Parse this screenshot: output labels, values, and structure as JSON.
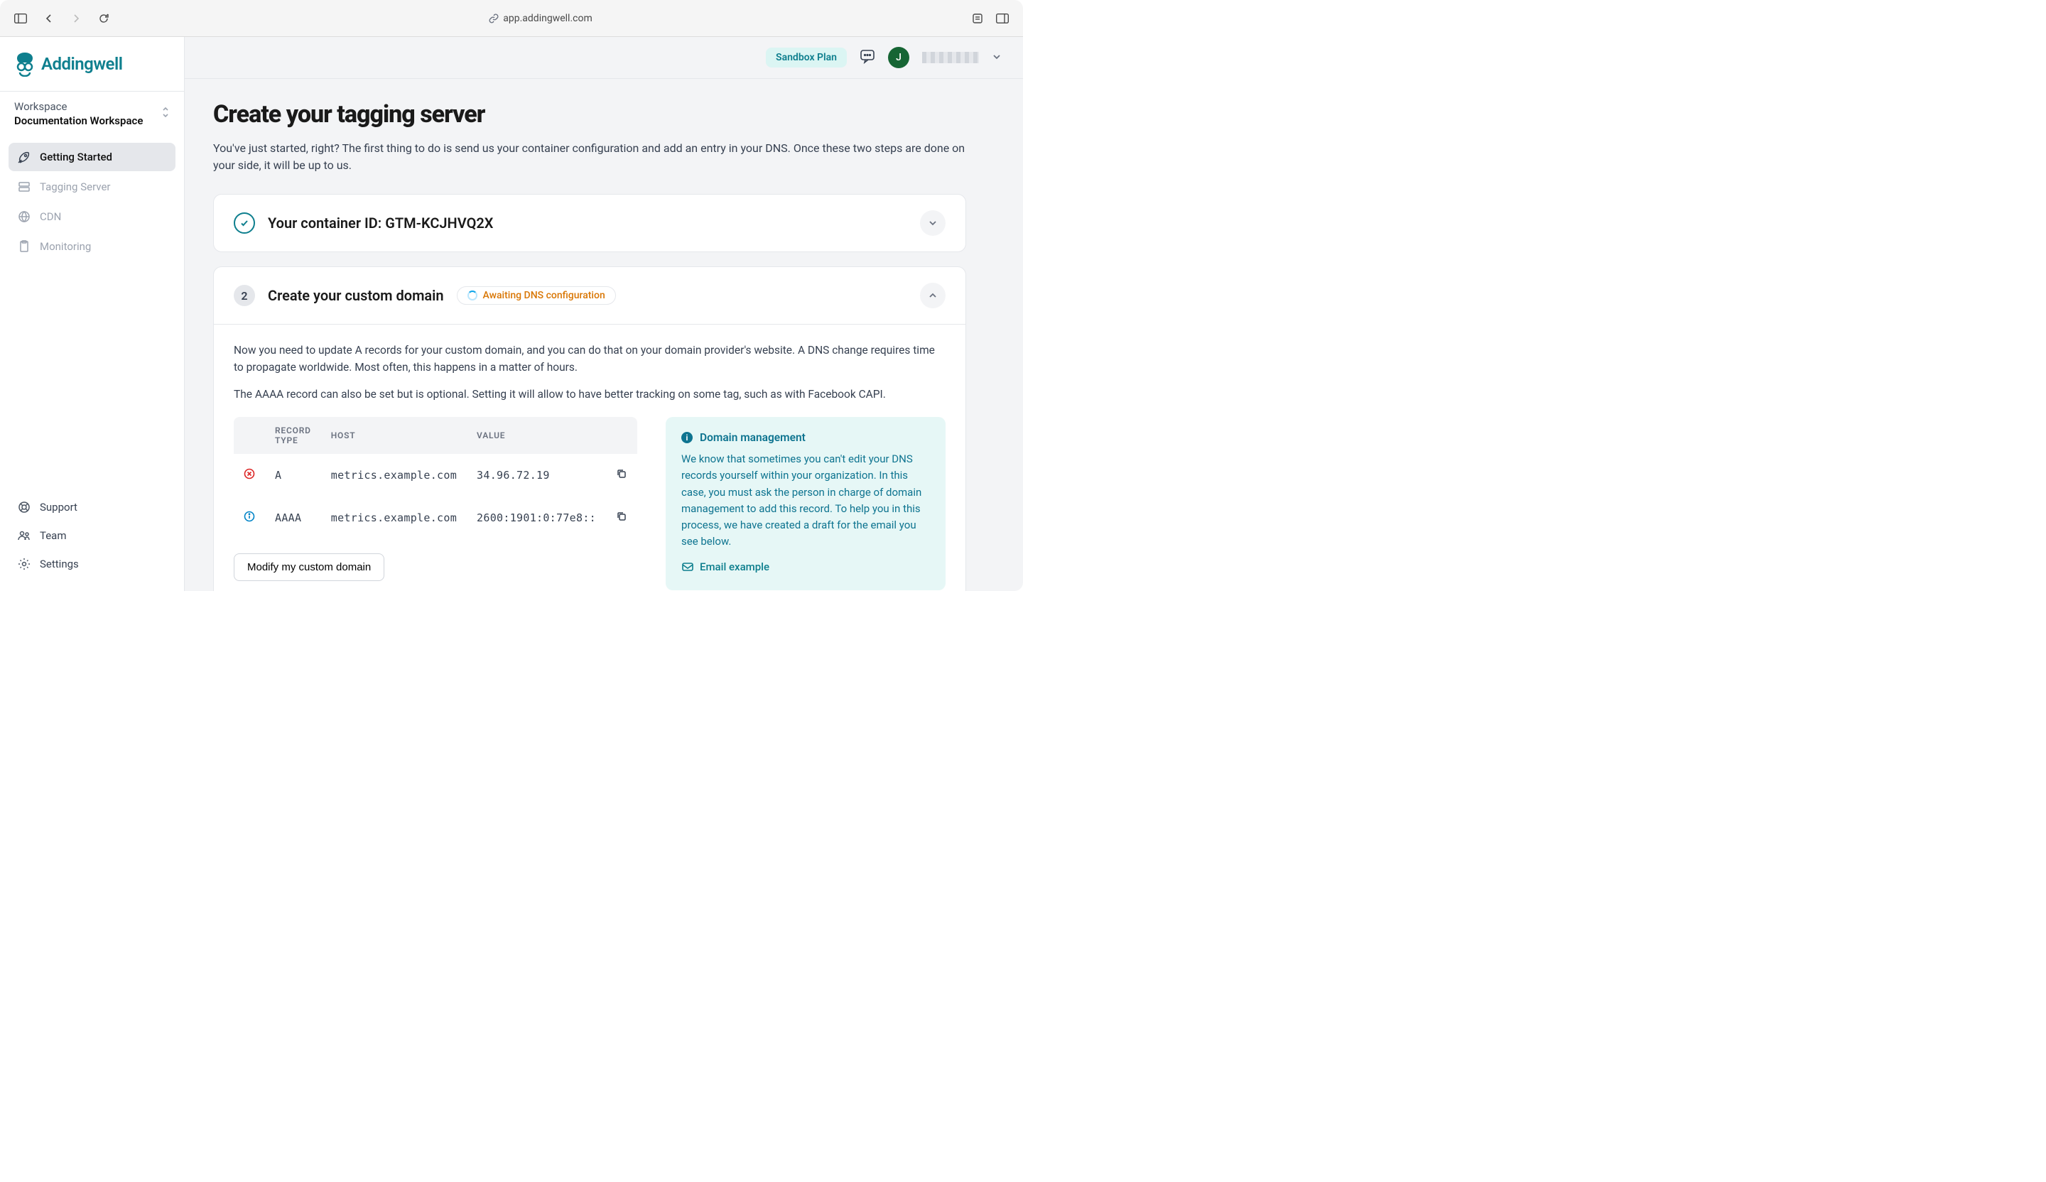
{
  "browser": {
    "url": "app.addingwell.com"
  },
  "brand": {
    "name": "Addingwell"
  },
  "workspace": {
    "label": "Workspace",
    "name": "Documentation Workspace"
  },
  "nav": {
    "items": [
      {
        "label": "Getting Started"
      },
      {
        "label": "Tagging Server"
      },
      {
        "label": "CDN"
      },
      {
        "label": "Monitoring"
      }
    ],
    "bottom": [
      {
        "label": "Support"
      },
      {
        "label": "Team"
      },
      {
        "label": "Settings"
      }
    ]
  },
  "topbar": {
    "plan": "Sandbox Plan",
    "avatar_initial": "J"
  },
  "page": {
    "title": "Create your tagging server",
    "intro": "You've just started, right? The first thing to do is send us your container configuration and add an entry in your DNS. Once these two steps are done on your side, it will be up to us."
  },
  "step1": {
    "title_prefix": "Your container ID: ",
    "container_id": "GTM-KCJHVQ2X"
  },
  "step2": {
    "number": "2",
    "title": "Create your custom domain",
    "status": "Awaiting DNS configuration",
    "body1": "Now you need to update A records for your custom domain, and you can do that on your domain provider's website. A DNS change requires time to propagate worldwide. Most often, this happens in a matter of hours.",
    "body2": "The AAAA record can also be set but is optional. Setting it will allow to have better tracking on some tag, such as with Facebook CAPI.",
    "table": {
      "headers": {
        "type": "RECORD TYPE",
        "host": "HOST",
        "value": "VALUE"
      },
      "rows": [
        {
          "type": "A",
          "host": "metrics.example.com",
          "value": "34.96.72.19"
        },
        {
          "type": "AAAA",
          "host": "metrics.example.com",
          "value": "2600:1901:0:77e8::"
        }
      ]
    },
    "info": {
      "title": "Domain management",
      "text": "We know that sometimes you can't edit your DNS records yourself within your organization. In this case, you must ask the person in charge of domain management to add this record. To help you in this process, we have created a draft for the email you see below.",
      "link": "Email example"
    },
    "modify_button": "Modify my custom domain"
  }
}
